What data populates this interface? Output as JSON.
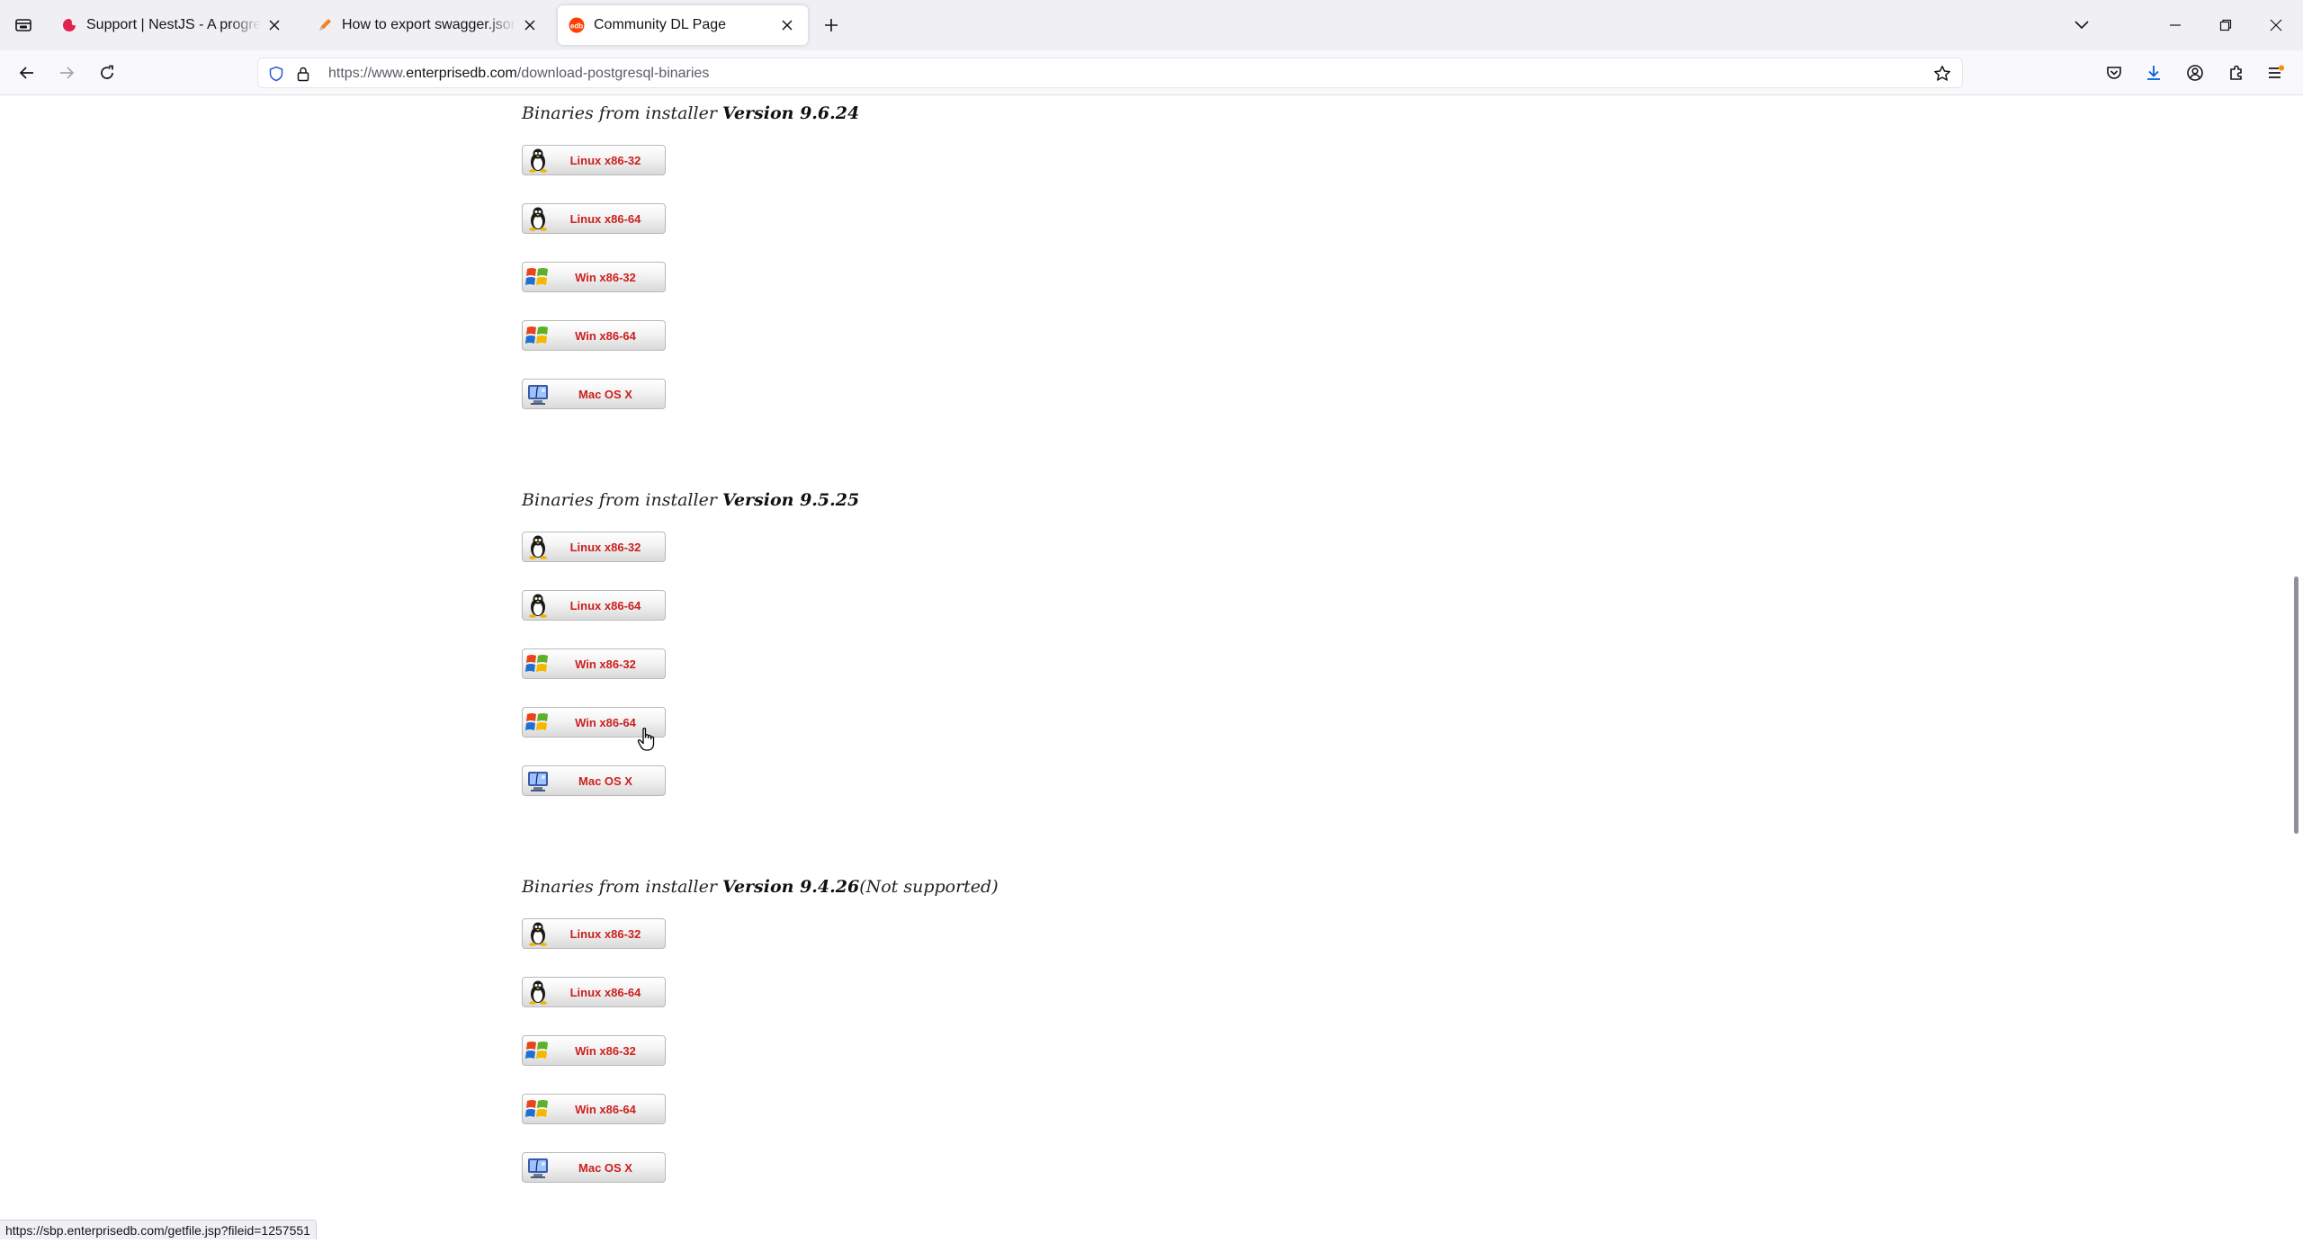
{
  "browser": {
    "tabs": [
      {
        "title": "Support | NestJS - A progressive Node.js framework",
        "favicon": "nestjs-favicon",
        "active": false
      },
      {
        "title": "How to export swagger.json (or yaml)",
        "favicon": "pen-favicon",
        "active": false
      },
      {
        "title": "Community DL Page",
        "favicon": "edb-favicon",
        "active": true
      }
    ],
    "url_prefix": "https://www.",
    "url_domain": "enterprisedb.com",
    "url_path": "/download-postgresql-binaries",
    "status_url": "https://sbp.enterprisedb.com/getfile.jsp?fileid=1257551"
  },
  "page": {
    "heading_prefix": "Binaries from installer ",
    "sections": [
      {
        "version": "Version 9.6.24",
        "suffix": "",
        "buttons": [
          {
            "label": "Linux x86-32",
            "os": "linux"
          },
          {
            "label": "Linux x86-64",
            "os": "linux"
          },
          {
            "label": "Win x86-32",
            "os": "windows"
          },
          {
            "label": "Win x86-64",
            "os": "windows"
          },
          {
            "label": "Mac OS X",
            "os": "mac"
          }
        ]
      },
      {
        "version": "Version 9.5.25",
        "suffix": "",
        "buttons": [
          {
            "label": "Linux x86-32",
            "os": "linux"
          },
          {
            "label": "Linux x86-64",
            "os": "linux"
          },
          {
            "label": "Win x86-32",
            "os": "windows"
          },
          {
            "label": "Win x86-64",
            "os": "windows"
          },
          {
            "label": "Mac OS X",
            "os": "mac"
          }
        ]
      },
      {
        "version": "Version 9.4.26",
        "suffix": "(Not supported)",
        "buttons": [
          {
            "label": "Linux x86-32",
            "os": "linux"
          },
          {
            "label": "Linux x86-64",
            "os": "linux"
          },
          {
            "label": "Win x86-32",
            "os": "windows"
          },
          {
            "label": "Win x86-64",
            "os": "windows"
          },
          {
            "label": "Mac OS X",
            "os": "mac"
          }
        ]
      }
    ]
  },
  "colors": {
    "button_text": "#cc1f1f",
    "tabstrip_bg": "#f0f0f4",
    "navbar_bg": "#f9f9fb",
    "download_icon_accent": "#0060df"
  }
}
